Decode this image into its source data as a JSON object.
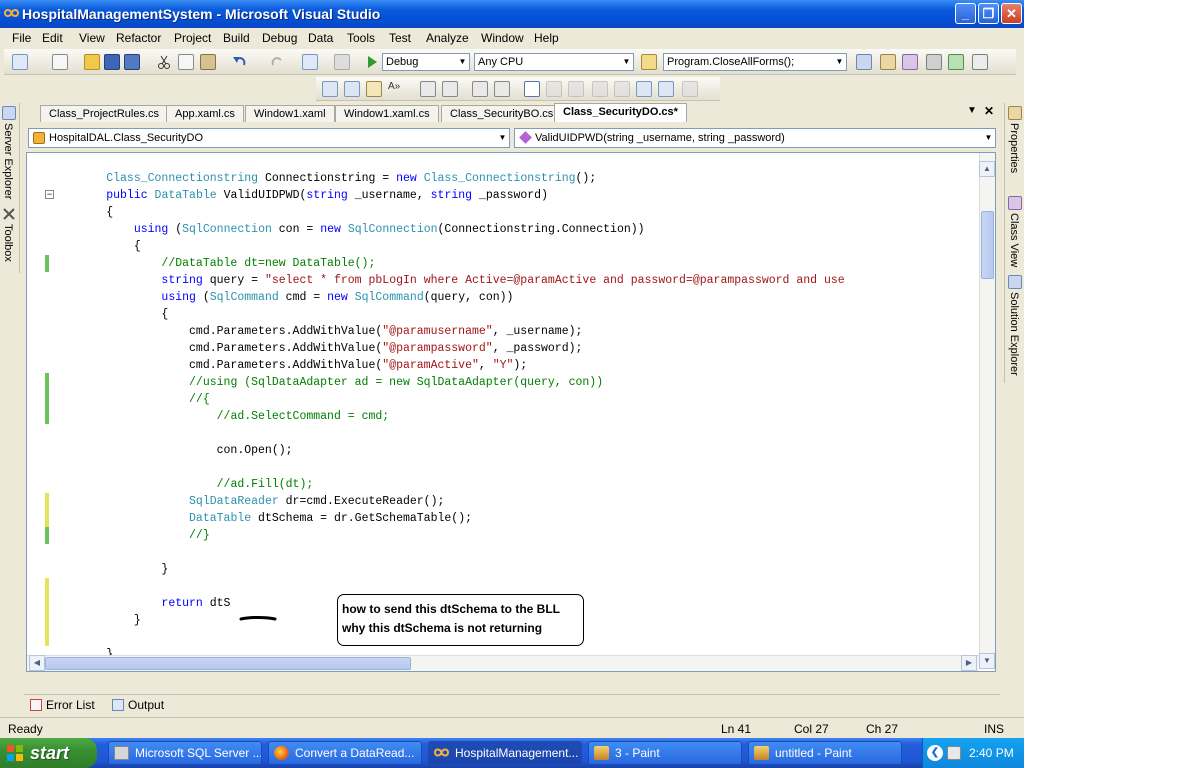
{
  "window": {
    "title": "HospitalManagementSystem - Microsoft Visual Studio",
    "minimize": "_",
    "maximize": "❐",
    "close": "✕"
  },
  "menu": [
    "File",
    "Edit",
    "View",
    "Refactor",
    "Project",
    "Build",
    "Debug",
    "Data",
    "Tools",
    "Test",
    "Analyze",
    "Window",
    "Help"
  ],
  "toolbar": {
    "config": "Debug",
    "platform": "Any CPU",
    "find": "Program.CloseAllForms();"
  },
  "sidebars": {
    "left": [
      "Server Explorer",
      "Toolbox"
    ],
    "right": [
      "Properties",
      "Class View",
      "Solution Explorer"
    ]
  },
  "tabs": [
    "Class_ProjectRules.cs",
    "App.xaml.cs",
    "Window1.xaml",
    "Window1.xaml.cs",
    "Class_SecurityBO.cs",
    "Class_SecurityDO.cs*"
  ],
  "tab_controls": {
    "dropdown": "▼",
    "close": "✕"
  },
  "nav": {
    "type": "HospitalDAL.Class_SecurityDO",
    "member": "ValidUIDPWD(string _username, string _password)"
  },
  "code": [
    "        Class_Connectionstring Connectionstring = new Class_Connectionstring();",
    "        public DataTable ValidUIDPWD(string _username, string _password)",
    "        {",
    "            using (SqlConnection con = new SqlConnection(Connectionstring.Connection))",
    "            {",
    "                //DataTable dt=new DataTable();",
    "                string query = \"select * from pbLogIn where Active=@paramActive and password=@parampassword and use",
    "                using (SqlCommand cmd = new SqlCommand(query, con))",
    "                {",
    "                    cmd.Parameters.AddWithValue(\"@paramusername\", _username);",
    "                    cmd.Parameters.AddWithValue(\"@parampassword\", _password);",
    "                    cmd.Parameters.AddWithValue(\"@paramActive\", \"Y\");",
    "                    //using (SqlDataAdapter ad = new SqlDataAdapter(query, con))",
    "                    //{",
    "                        //ad.SelectCommand = cmd;",
    "",
    "                        con.Open();",
    "",
    "                        //ad.Fill(dt);",
    "                    SqlDataReader dr=cmd.ExecuteReader();",
    "                    DataTable dtSchema = dr.GetSchemaTable();",
    "                    //}",
    "",
    "                }",
    "",
    "                return dtS",
    "            }",
    "",
    "        }"
  ],
  "callout": {
    "line1": "how to send this dtSchema to the BLL",
    "line2": "why this dtSchema is not returning"
  },
  "bottom_tabs": [
    "Error List",
    "Output"
  ],
  "status": {
    "ready": "Ready",
    "ln": "Ln 41",
    "col": "Col 27",
    "ch": "Ch 27",
    "mode": "INS"
  },
  "taskbar": {
    "start": "start",
    "tasks": [
      "Microsoft SQL Server ...",
      "Convert a DataRead...",
      "HospitalManagement...",
      "3 - Paint",
      "untitled - Paint"
    ],
    "time": "2:40 PM"
  },
  "colors": {
    "keyword": "#0000ff",
    "type": "#2b91af",
    "comment": "#008000",
    "string": "#a31515",
    "changed": "#6cc35a",
    "unsaved": "#e6e35a"
  }
}
